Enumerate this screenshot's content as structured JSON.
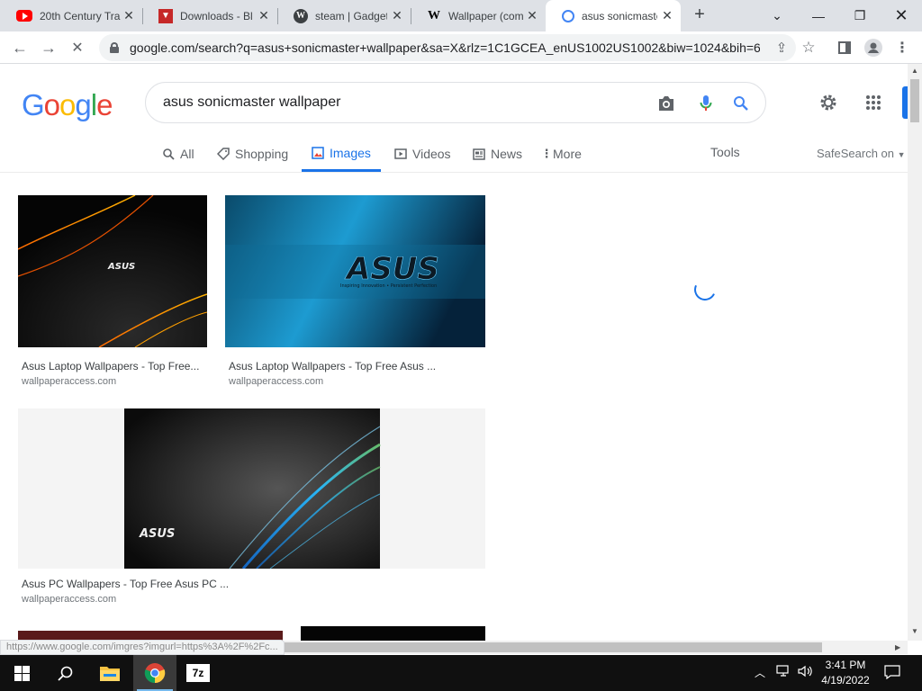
{
  "browser": {
    "tabs": [
      {
        "title": "20th Century Tra",
        "favicon": "youtube-icon"
      },
      {
        "title": "Downloads - Bl",
        "favicon": "download-icon"
      },
      {
        "title": "steam | Gadget",
        "favicon": "wordpress-icon"
      },
      {
        "title": "Wallpaper (com",
        "favicon": "wikipedia-icon"
      },
      {
        "title": "asus sonicmaste",
        "favicon": "google-icon",
        "active": true
      }
    ],
    "url": "google.com/search?q=asus+sonicmaster+wallpaper&sa=X&rlz=1C1GCEA_enUS1002US1002&biw=1024&bih=6...",
    "status_url": "https://www.google.com/imgres?imgurl=https%3A%2F%2Fc..."
  },
  "search": {
    "logo": "Google",
    "query": "asus sonicmaster wallpaper",
    "tabs": [
      {
        "label": "All",
        "icon": "search-icon"
      },
      {
        "label": "Shopping",
        "icon": "tag-icon"
      },
      {
        "label": "Images",
        "icon": "image-icon",
        "active": true
      },
      {
        "label": "Videos",
        "icon": "play-icon"
      },
      {
        "label": "News",
        "icon": "news-icon"
      },
      {
        "label": "More",
        "icon": "more-vert-icon"
      }
    ],
    "tools": "Tools",
    "safesearch": "SafeSearch on",
    "accent": "#1a73e8"
  },
  "results": [
    {
      "title": "Asus Laptop Wallpapers - Top Free...",
      "source": "wallpaperaccess.com",
      "brand": "ASUS"
    },
    {
      "title": "Asus Laptop Wallpapers - Top Free Asus ...",
      "source": "wallpaperaccess.com",
      "brand": "ASUS",
      "tagline": "Inspiring Innovation • Persistent Perfection"
    },
    {
      "title": "Asus PC Wallpapers - Top Free Asus PC ...",
      "source": "wallpaperaccess.com",
      "brand": "ASUS"
    }
  ],
  "taskbar": {
    "time": "3:41 PM",
    "date": "4/19/2022",
    "apps": [
      "windows-start-icon",
      "search-icon",
      "file-explorer-icon",
      "chrome-icon",
      "7zip-icon"
    ],
    "sevenzip_label": "7z"
  }
}
